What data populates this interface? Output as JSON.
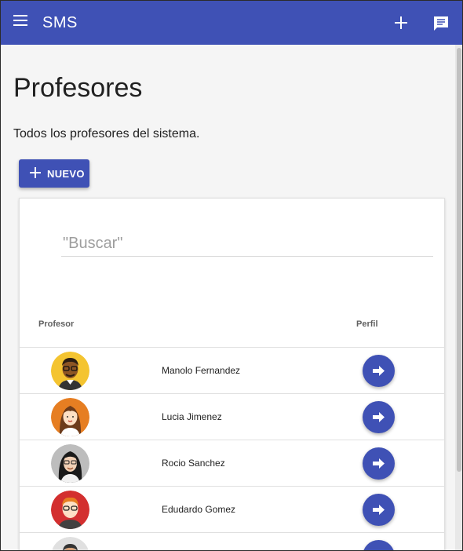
{
  "appbar": {
    "title": "SMS",
    "menu_icon": "menu-icon",
    "add_icon": "plus-icon",
    "chat_icon": "chat-icon"
  },
  "page": {
    "title": "Profesores",
    "subtitle": "Todos los profesores del sistema."
  },
  "new_button": {
    "label": "NUEVO",
    "icon": "plus-icon"
  },
  "search": {
    "placeholder": "\"Buscar\""
  },
  "table": {
    "columns": [
      "Profesor",
      "Perfil"
    ],
    "rows": [
      {
        "name": "Manolo Fernandez",
        "avatar": "avatar-man-glasses",
        "avatar_bg": "#f4c430"
      },
      {
        "name": "Lucia Jimenez",
        "avatar": "avatar-woman-long-hair",
        "avatar_bg": "#e67e22"
      },
      {
        "name": "Rocio Sanchez",
        "avatar": "avatar-woman-photo",
        "avatar_bg": "#bdbdbd"
      },
      {
        "name": "Edudardo Gomez",
        "avatar": "avatar-man-red",
        "avatar_bg": "#d32f2f"
      }
    ],
    "profile_icon": "arrow-right-icon"
  },
  "colors": {
    "primary": "#3f51b5",
    "background": "#f5f5f5"
  }
}
